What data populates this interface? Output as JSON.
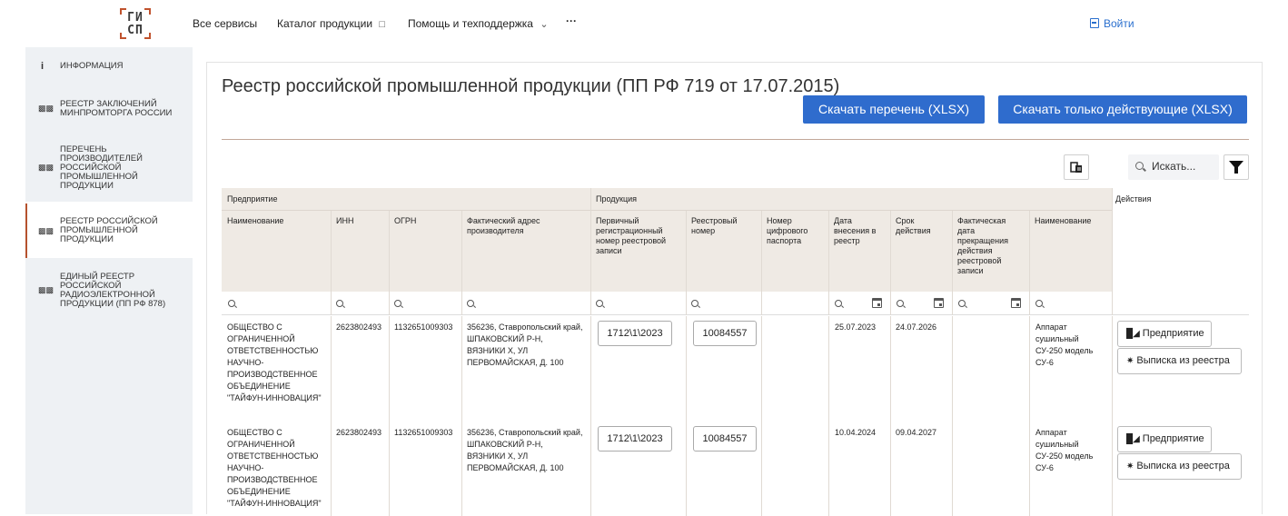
{
  "header": {
    "logo_text": "ГИСП",
    "nav": [
      {
        "label": "Все сервисы"
      },
      {
        "label": "Каталог продукции",
        "icon": "chat-icon"
      },
      {
        "label": "Помощь и техподдержка",
        "icon": "chevron-down-icon"
      },
      {
        "label": "···"
      }
    ],
    "login_label": "Войти"
  },
  "sidebar": {
    "items": [
      {
        "label": "Информация",
        "icon": "info-icon"
      },
      {
        "label": "Реестр заключений Минпромторга России",
        "icon": "book-icon"
      },
      {
        "label": "Перечень производителей российской промышленной продукции",
        "icon": "book-icon"
      },
      {
        "label": "Реестр российской промышленной продукции",
        "icon": "book-icon",
        "active": true
      },
      {
        "label": "Единый реестр российской радиоэлектронной продукции (ПП РФ 878)",
        "icon": "book-icon"
      }
    ]
  },
  "main": {
    "title": "Реестр российской промышленной продукции (ПП РФ 719 от 17.07.2015)",
    "buttons": {
      "download_all": "Скачать перечень (XLSX)",
      "download_active": "Скачать только действующие (XLSX)"
    },
    "search_placeholder": "Искать...",
    "table": {
      "group_enterprise": "Предприятие",
      "group_product": "Продукция",
      "group_actions": "Действия",
      "columns": [
        "Наименование",
        "ИНН",
        "ОГРН",
        "Фактический адрес производителя",
        "Первичный регистрационный номер реестровой записи",
        "Реестровый номер",
        "Номер цифрового паспорта",
        "Дата внесения в реестр",
        "Срок действия",
        "Фактическая дата прекращения действия реестровой записи",
        "Наименование"
      ],
      "rows": [
        {
          "name": "ОБЩЕСТВО С ОГРАНИЧЕННОЙ ОТВЕТСТВЕННОСТЬЮ НАУЧНО-ПРОИЗВОДСТВЕННОЕ ОБЪЕДИНЕНИЕ \"ТАЙФУН-ИННОВАЦИЯ\"",
          "inn": "2623802493",
          "ogrn": "1132651009303",
          "address": "356236, Ставропольский край, ШПАКОВСКИЙ Р-Н, ВЯЗНИКИ Х, УЛ ПЕРВОМАЙСКАЯ, Д. 100",
          "primary_number": "1712\\1\\2023",
          "registry_number": "10084557",
          "passport": "",
          "date_added": "25.07.2023",
          "valid_until": "24.07.2026",
          "end_date": "",
          "product": "Аппарат сушильный СУ-250 модель СУ-6"
        },
        {
          "name": "ОБЩЕСТВО С ОГРАНИЧЕННОЙ ОТВЕТСТВЕННОСТЬЮ НАУЧНО-ПРОИЗВОДСТВЕННОЕ ОБЪЕДИНЕНИЕ \"ТАЙФУН-ИННОВАЦИЯ\"",
          "inn": "2623802493",
          "ogrn": "1132651009303",
          "address": "356236, Ставропольский край, ШПАКОВСКИЙ Р-Н, ВЯЗНИКИ Х, УЛ ПЕРВОМАЙСКАЯ, Д. 100",
          "primary_number": "1712\\1\\2023",
          "registry_number": "10084557",
          "passport": "",
          "date_added": "10.04.2024",
          "valid_until": "09.04.2027",
          "end_date": "",
          "product": "Аппарат сушильный СУ-250 модель СУ-6"
        }
      ],
      "actions": {
        "enterprise": "Предприятие",
        "extract": "Выписка из реестра"
      }
    }
  },
  "colors": {
    "accent": "#2f6ccd",
    "logo_corner": "#c0522d",
    "header_band": "#efeae4",
    "sidebar_bg": "#eef1f4"
  }
}
